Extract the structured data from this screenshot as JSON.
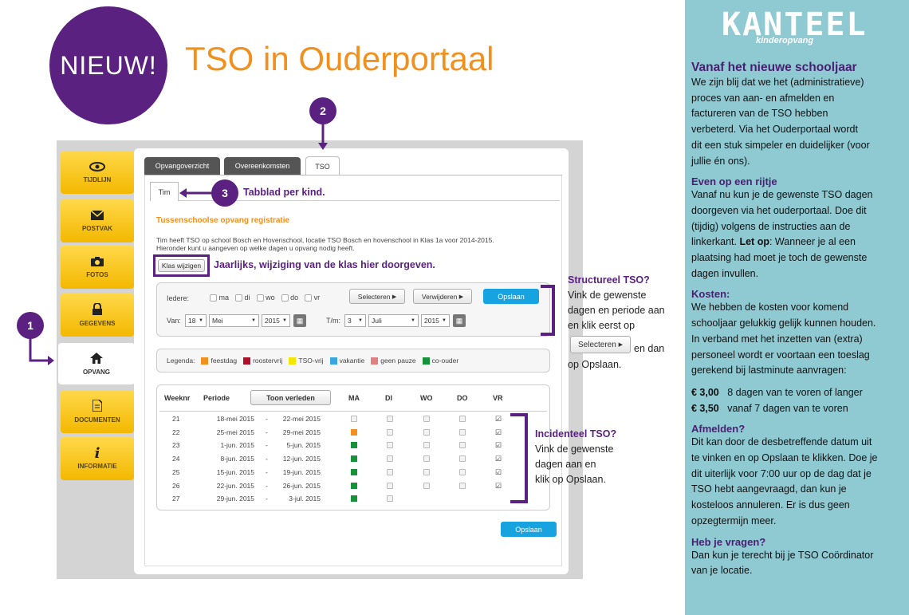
{
  "header": {
    "badge": "NIEUW!",
    "title": "TSO in Ouderportaal"
  },
  "nav": [
    {
      "label": "TIJDLIJN",
      "icon": "eye-icon"
    },
    {
      "label": "POSTVAK",
      "icon": "envelope-icon"
    },
    {
      "label": "FOTOS",
      "icon": "camera-icon"
    },
    {
      "label": "GEGEVENS",
      "icon": "lock-icon"
    },
    {
      "label": "OPVANG",
      "icon": "home-icon"
    },
    {
      "label": "DOCUMENTEN",
      "icon": "document-icon"
    },
    {
      "label": "INFORMATIE",
      "icon": "info-icon"
    }
  ],
  "tabs": {
    "t1": "Opvangoverzicht",
    "t2": "Overeenkomsten",
    "t3": "TSO"
  },
  "child_tab": "Tim",
  "section_title": "Tussenschoolse opvang registratie",
  "intro_line1": "Tim heeft TSO op school Bosch en Hovenschool, locatie TSO Bosch en hovenschool in Klas 1a voor 2014-2015.",
  "intro_line2": "Hieronder kunt u aangeven op welke dagen u opvang nodig heeft.",
  "klas_button": "Klas wijzigen",
  "filter": {
    "iedere_label": "Iedere:",
    "days": [
      "ma",
      "di",
      "wo",
      "do",
      "vr"
    ],
    "select_button": "Selecteren",
    "remove_button": "Verwijderen",
    "save_button": "Opslaan",
    "van_label": "Van:",
    "van_day": "18",
    "van_month": "Mei",
    "van_year": "2015",
    "tm_label": "T/m:",
    "tm_day": "3",
    "tm_month": "Juli",
    "tm_year": "2015"
  },
  "legend": {
    "label": "Legenda:",
    "items": [
      {
        "name": "feestdag",
        "color": "#f0901e"
      },
      {
        "name": "roostervrij",
        "color": "#b0102a"
      },
      {
        "name": "TSO-vrij",
        "color": "#f5e600"
      },
      {
        "name": "vakantie",
        "color": "#3aa6e0"
      },
      {
        "name": "geen pauze",
        "color": "#e08080"
      },
      {
        "name": "co-ouder",
        "color": "#17913a"
      }
    ]
  },
  "table": {
    "headers": {
      "week": "Weeknr",
      "periode": "Periode",
      "hide_button": "Toon verleden",
      "ma": "MA",
      "di": "DI",
      "wo": "WO",
      "do": "DO",
      "vr": "VR"
    },
    "rows": [
      {
        "week": "21",
        "from": "18-mei 2015",
        "sep": "-",
        "to": "22-mei 2015",
        "ma": "empty",
        "di": "empty",
        "wo": "empty",
        "do": "empty",
        "vr": "checked"
      },
      {
        "week": "22",
        "from": "25-mei 2015",
        "sep": "-",
        "to": "29-mei 2015",
        "ma": "orange",
        "di": "empty",
        "wo": "empty",
        "do": "empty",
        "vr": "checked"
      },
      {
        "week": "23",
        "from": "1-jun. 2015",
        "sep": "-",
        "to": "5-jun. 2015",
        "ma": "green",
        "di": "empty",
        "wo": "empty",
        "do": "empty",
        "vr": "checked"
      },
      {
        "week": "24",
        "from": "8-jun. 2015",
        "sep": "-",
        "to": "12-jun. 2015",
        "ma": "green",
        "di": "empty",
        "wo": "empty",
        "do": "empty",
        "vr": "checked"
      },
      {
        "week": "25",
        "from": "15-jun. 2015",
        "sep": "-",
        "to": "19-jun. 2015",
        "ma": "green",
        "di": "empty",
        "wo": "empty",
        "do": "empty",
        "vr": "checked"
      },
      {
        "week": "26",
        "from": "22-jun. 2015",
        "sep": "-",
        "to": "26-jun. 2015",
        "ma": "green",
        "di": "empty",
        "wo": "empty",
        "do": "empty",
        "vr": "checked"
      },
      {
        "week": "27",
        "from": "29-jun. 2015",
        "sep": "-",
        "to": "3-jul. 2015",
        "ma": "green",
        "di": "empty",
        "wo": "none",
        "do": "none",
        "vr": "none"
      }
    ],
    "save_button": "Opslaan"
  },
  "annotations": {
    "n1": "1",
    "n2": "2",
    "n3": "3",
    "tabblad": "Tabblad per kind.",
    "klas": "Jaarlijks, wijziging van de klas hier doorgeven.",
    "structureel_title": "Structureel TSO?",
    "structureel_l1": "Vink de gewenste",
    "structureel_l2": "dagen en periode aan",
    "structureel_l3": "en klik eerst op",
    "structureel_btn": "Selecteren",
    "structureel_l4": "en dan",
    "structureel_l5": "op Opslaan.",
    "incidenteel_title": "Incidenteel TSO?",
    "incidenteel_l1": "Vink de gewenste",
    "incidenteel_l2": "dagen aan en",
    "incidenteel_l3": "klik op Opslaan."
  },
  "sidebar": {
    "logo": "KANTEEL",
    "logo_sub": "kinderopvang",
    "h1": "Vanaf het nieuwe schooljaar",
    "p1": [
      "We zijn blij dat we het (administratieve)",
      "proces van aan- en afmelden en",
      "factureren van de TSO hebben",
      "verbeterd. Via het Ouderportaal wordt",
      "dit een stuk simpeler en duidelijker (voor",
      "jullie én ons)."
    ],
    "h2": "Even op een rijtje",
    "p2": [
      "Vanaf nu kun je de gewenste TSO dagen",
      "doorgeven via het ouderportaal. Doe dit",
      "(tijdig) volgens de instructies aan de",
      "linkerkant."
    ],
    "p2_bold": "Let op",
    "p2_rest": [
      ": Wanneer je al een",
      "plaatsing had moet je toch de gewenste",
      "dagen invullen."
    ],
    "h3": "Kosten:",
    "p3": [
      "We hebben de kosten voor komend",
      "schooljaar gelukkig gelijk kunnen houden.",
      "In verband met het inzetten van (extra)",
      "personeel wordt er voortaan een toeslag",
      "gerekend bij lastminute aanvragen:"
    ],
    "price1": "€ 3,00",
    "price1_text": "8 dagen van te voren of langer",
    "price2": "€ 3,50",
    "price2_text": "vanaf 7 dagen van te voren",
    "h4": "Afmelden?",
    "p4": [
      "Dit kan door de desbetreffende datum uit",
      "te vinken en op Opslaan te klikken. Doe je",
      "dit uiterlijk voor 7:00 uur op de dag dat je",
      "TSO hebt aangevraagd, dan kun je",
      "kosteloos annuleren. Er is dus geen",
      "opzegtermijn meer."
    ],
    "h5": "Heb je vragen?",
    "p5": [
      "Dan kun je terecht bij je TSO Coördinator",
      "van je locatie."
    ]
  }
}
